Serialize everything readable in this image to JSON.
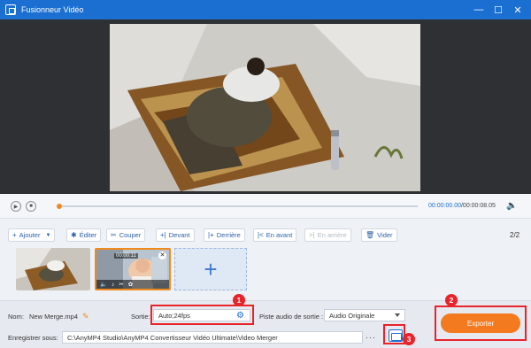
{
  "window": {
    "title": "Fusionneur Vidéo",
    "icons": [
      "app-icon",
      "minimize-icon",
      "maximize-icon",
      "close-icon"
    ]
  },
  "player": {
    "current_time": "00:00:00.00",
    "total_time": "/00:00:08.05",
    "progress": 0.0,
    "icons": [
      "play-icon",
      "stop-icon",
      "volume-icon"
    ]
  },
  "toolbar": {
    "add": "Ajouter",
    "edit": "Éditer",
    "cut": "Couper",
    "before": "Devant",
    "after": "Derrière",
    "forward": "En avant",
    "backward": "En arrière",
    "clear": "Vider",
    "page": "2/2"
  },
  "clips": [
    {
      "duration": "",
      "selected": false
    },
    {
      "duration": "00:00:11",
      "selected": true
    }
  ],
  "output": {
    "name_label": "Nom:",
    "name_value": "New Merge.mp4",
    "output_label": "Sortie:",
    "output_value": "Auto;24fps",
    "audio_label": "Piste audio de sortie :",
    "audio_value": "Audio Originale",
    "save_label": "Enregistrer sous:",
    "save_path": "C:\\AnyMP4 Studio\\AnyMP4 Convertisseur Vidéo Ultimate\\Video Merger",
    "browse": "···",
    "export": "Exporter"
  },
  "annotations": {
    "m1": "1",
    "m2": "2",
    "m3": "3"
  },
  "colors": {
    "titlebar": "#1a6fd1",
    "accent": "#f08a1c",
    "export": "#f47a1f",
    "highlight": "#e8232a"
  }
}
